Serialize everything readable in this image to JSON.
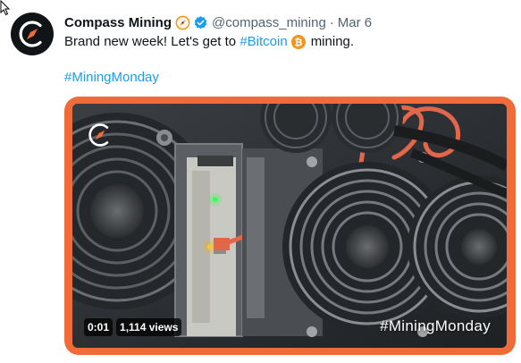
{
  "tweet": {
    "display_name": "Compass Mining",
    "handle": "@compass_mining",
    "separator": "·",
    "date": "Mar 6",
    "text_before": "Brand new week! Let's get to ",
    "hashtag_bitcoin": "#Bitcoin",
    "text_after": "mining.",
    "hashtag_line": "#MiningMonday",
    "icons": {
      "avatar": "compass-logo-icon",
      "badge": "compass-badge-icon",
      "verified": "verified-checkmark-icon",
      "bitcoin": "bitcoin-icon"
    },
    "colors": {
      "link": "#1d9bf0",
      "media_border": "#ef6b3a",
      "verified": "#1d9bf0",
      "bitcoin": "#f7931a"
    }
  },
  "video": {
    "timestamp": "0:01",
    "views": "1,114 views",
    "watermark": "#MiningMonday"
  }
}
